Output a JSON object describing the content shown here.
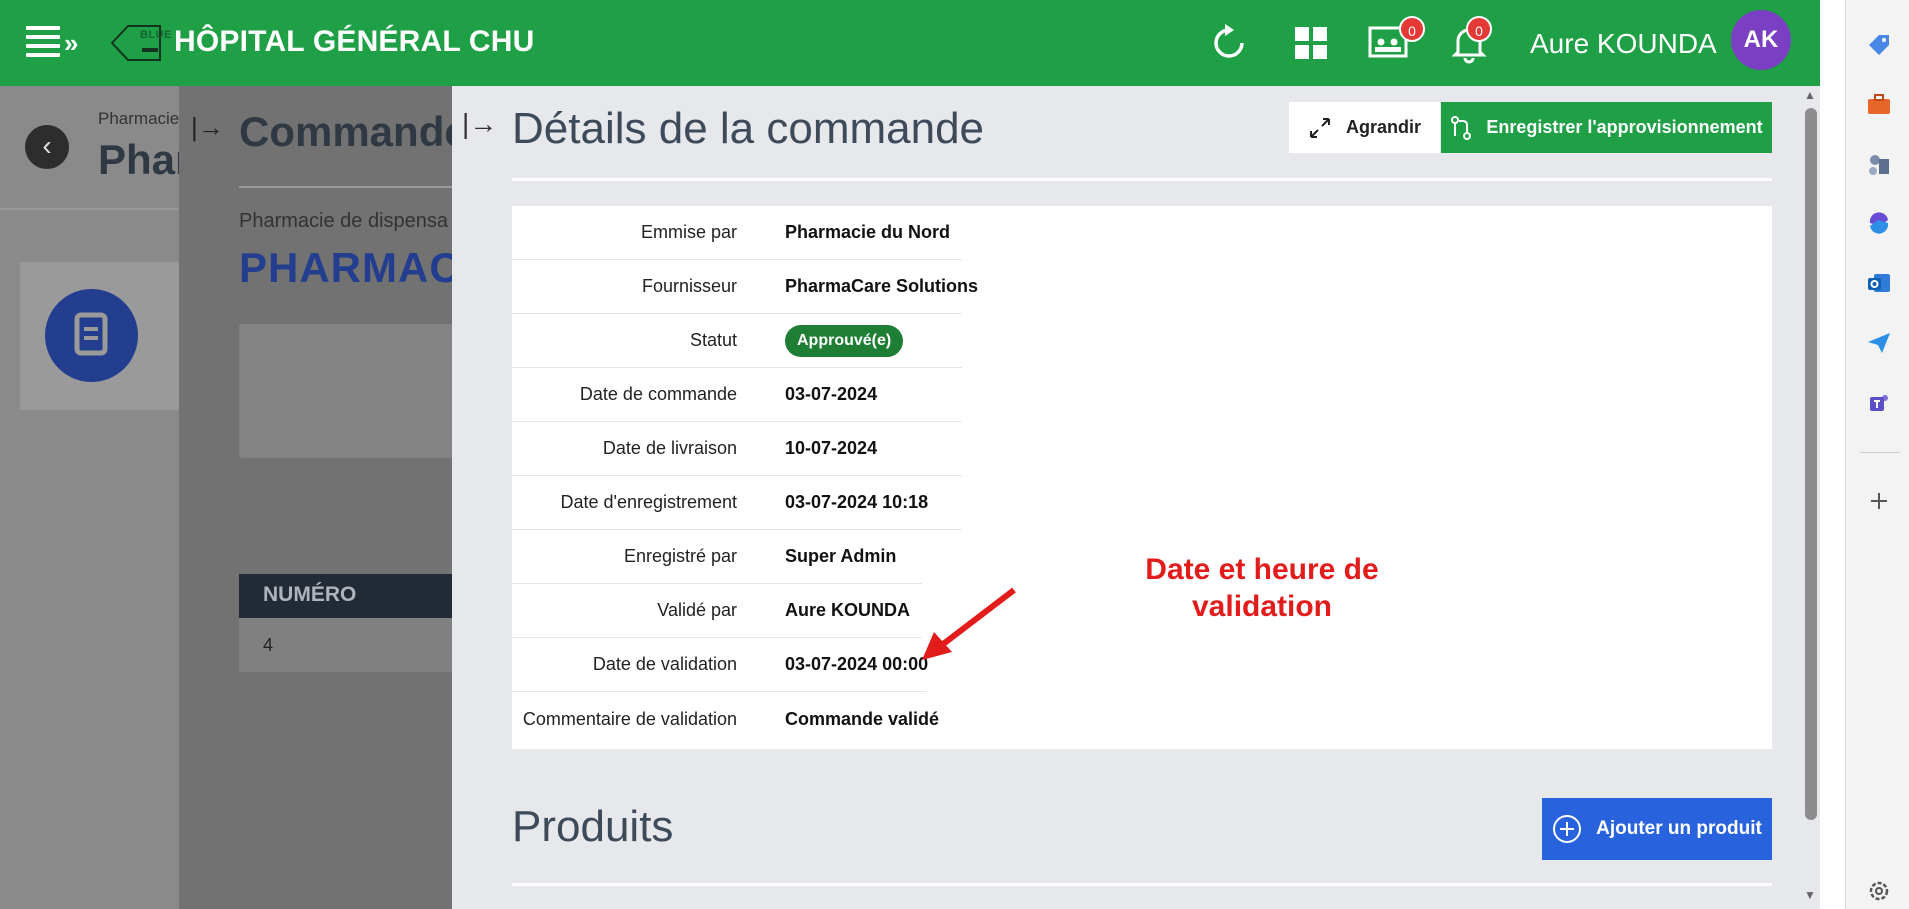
{
  "header": {
    "logo_text": "BLUE",
    "app_title": "HÔPITAL GÉNÉRAL CHU",
    "notif_count_1": "0",
    "notif_count_2": "0",
    "user_name": "Aure KOUNDA",
    "avatar_initials": "AK"
  },
  "background": {
    "breadcrumb": "Pharmacie",
    "title": "Phar"
  },
  "overlay2": {
    "title": "Commandes",
    "subtitle": "Pharmacie de dispensa",
    "big": "PHARMACI",
    "table_header": "NUMÉRO",
    "row_value": "4"
  },
  "panel": {
    "title": "Détails de la commande",
    "btn_expand": "Agrandir",
    "btn_register": "Enregistrer l'approvisionnement",
    "details": [
      {
        "label": "Emmise par",
        "value": "Pharmacie du Nord"
      },
      {
        "label": "Fournisseur",
        "value": "PharmaCare Solutions"
      },
      {
        "label": "Statut",
        "value": "Approuvé(e)"
      },
      {
        "label": "Date de commande",
        "value": "03-07-2024"
      },
      {
        "label": "Date de livraison",
        "value": "10-07-2024"
      },
      {
        "label": "Date d'enregistrement",
        "value": "03-07-2024 10:18"
      },
      {
        "label": "Enregistré par",
        "value": "Super Admin"
      },
      {
        "label": "Validé par",
        "value": "Aure KOUNDA"
      },
      {
        "label": "Date de validation",
        "value": "03-07-2024 00:00"
      },
      {
        "label": "Commentaire de validation",
        "value": "Commande validé"
      }
    ],
    "annotation_line1": "Date et heure de",
    "annotation_line2": "validation",
    "products_title": "Produits",
    "btn_add_product": "Ajouter un produit"
  },
  "colors": {
    "header_green": "#1fa046",
    "status_green": "#1e7e34",
    "add_blue": "#2962dd",
    "annotation_red": "#e21b1b",
    "avatar_purple": "#7b3fc4"
  }
}
